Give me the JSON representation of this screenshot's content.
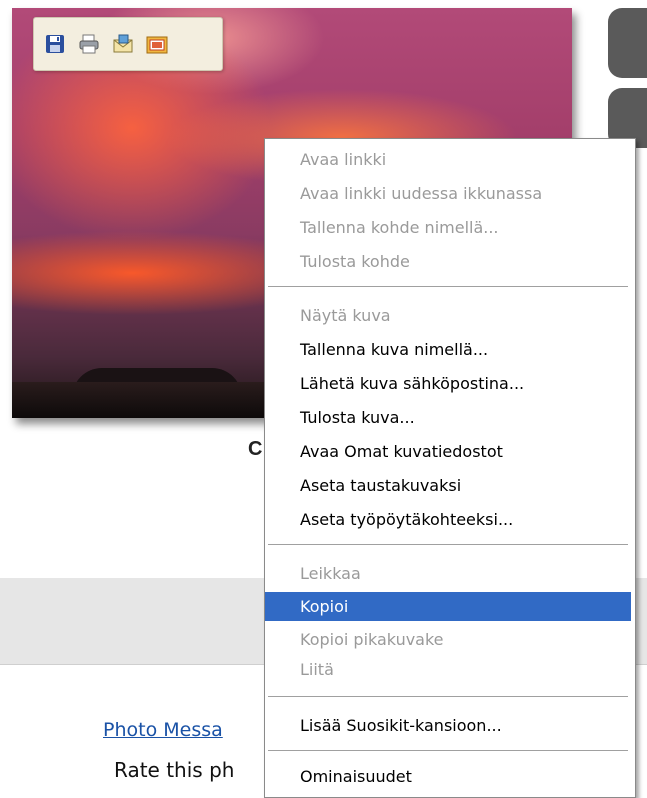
{
  "toolbar": {
    "icons": [
      "save-icon",
      "print-icon",
      "email-icon",
      "my-pictures-icon"
    ]
  },
  "caption": {
    "partial_text": "C"
  },
  "footer": {
    "photo_link": "Photo Messa",
    "rate_text": "Rate this ph"
  },
  "context_menu": {
    "items": [
      {
        "label": "Avaa linkki",
        "enabled": false
      },
      {
        "label": "Avaa linkki uudessa ikkunassa",
        "enabled": false
      },
      {
        "label": "Tallenna kohde nimellä...",
        "enabled": false
      },
      {
        "label": "Tulosta kohde",
        "enabled": false
      },
      {
        "label": "Näytä kuva",
        "enabled": false
      },
      {
        "label": "Tallenna kuva nimellä...",
        "enabled": true
      },
      {
        "label": "Lähetä kuva sähköpostina...",
        "enabled": true
      },
      {
        "label": "Tulosta kuva...",
        "enabled": true
      },
      {
        "label": "Avaa Omat kuvatiedostot",
        "enabled": true
      },
      {
        "label": "Aseta taustakuvaksi",
        "enabled": true
      },
      {
        "label": "Aseta työpöytäkohteeksi...",
        "enabled": true
      },
      {
        "label": "Leikkaa",
        "enabled": false
      },
      {
        "label": "Kopioi",
        "enabled": true,
        "selected": true
      },
      {
        "label": "Kopioi pikakuvake",
        "enabled": false
      },
      {
        "label": "Liitä",
        "enabled": false
      },
      {
        "label": "Lisää Suosikit-kansioon...",
        "enabled": true
      },
      {
        "label": "Ominaisuudet",
        "enabled": true
      }
    ]
  },
  "colors": {
    "menu_highlight": "#316ac5",
    "disabled_text": "#9a9a9a",
    "link": "#1a52a6"
  }
}
